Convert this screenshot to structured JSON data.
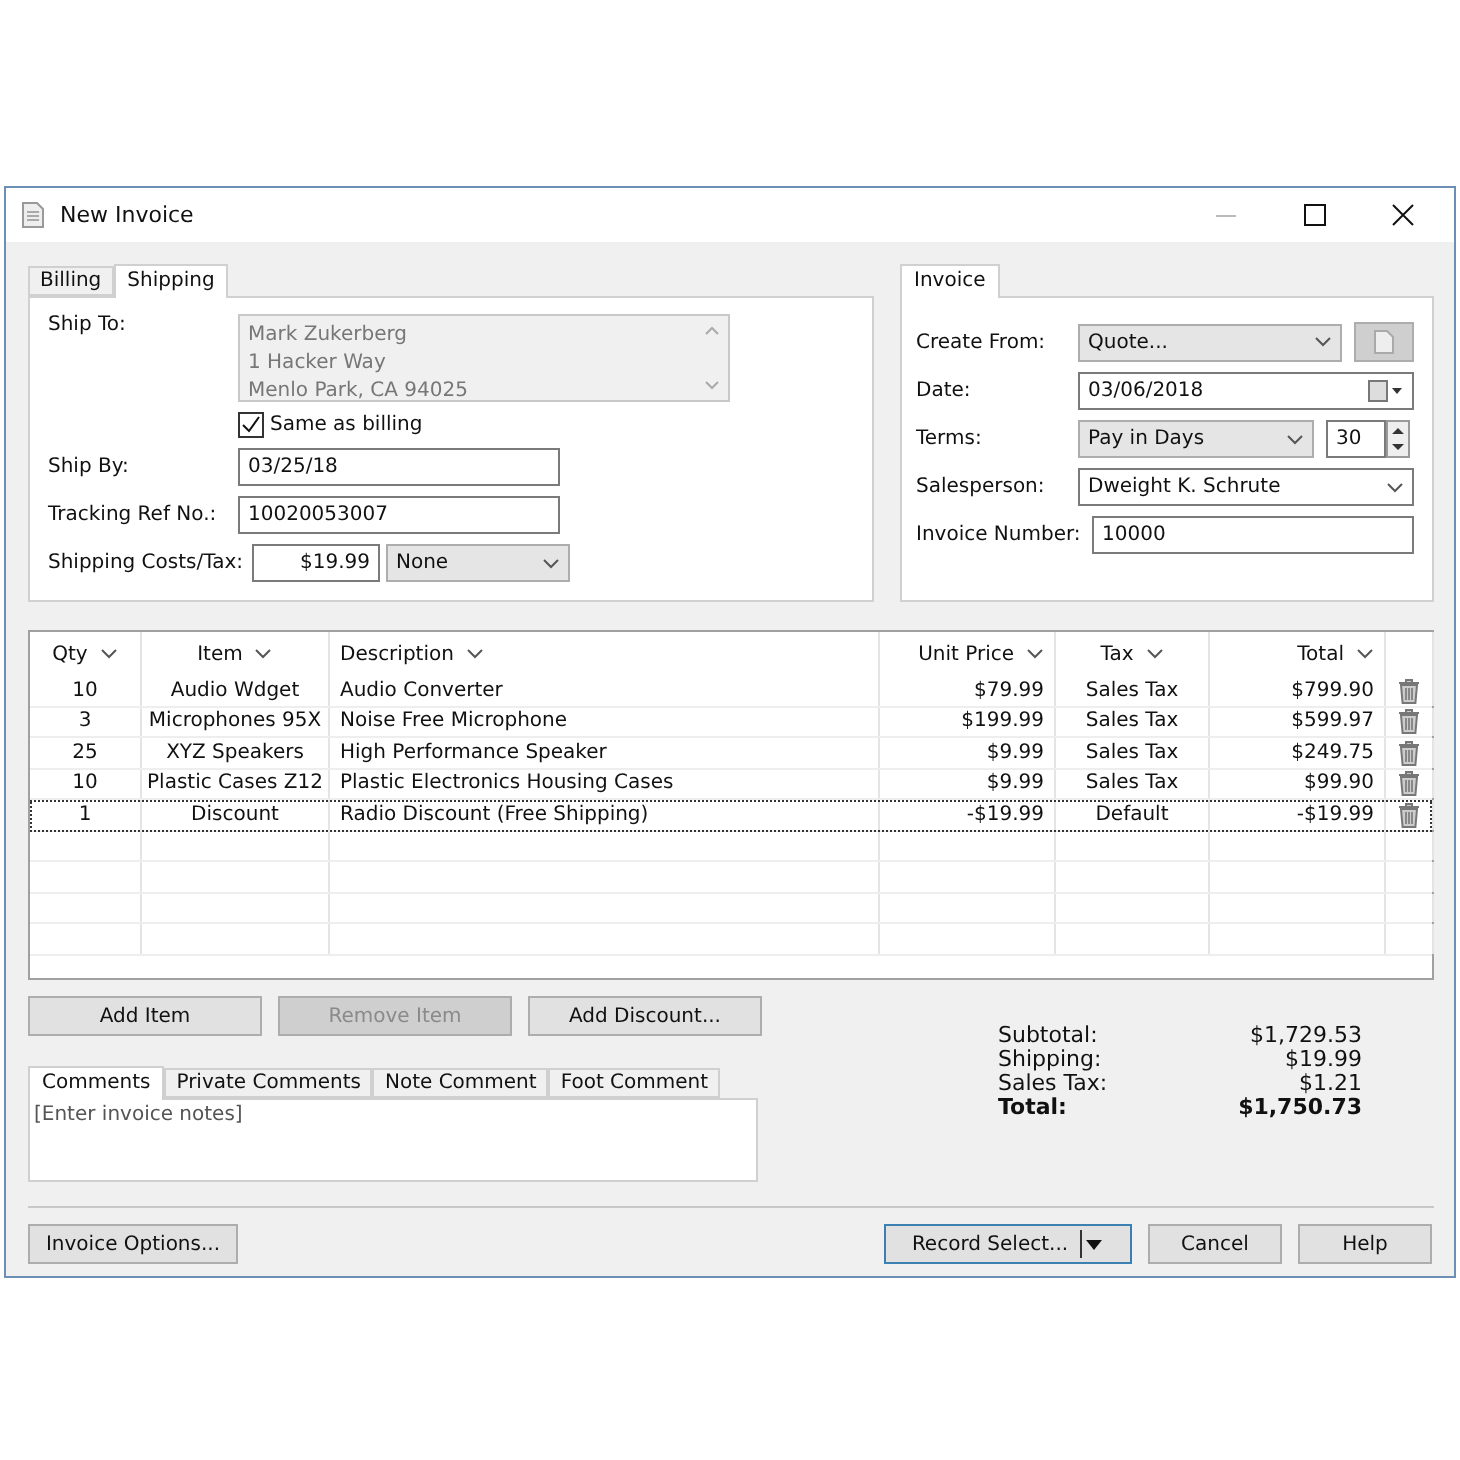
{
  "window": {
    "title": "New Invoice"
  },
  "address_tabs": [
    {
      "label": "Billing",
      "selected": false
    },
    {
      "label": "Shipping",
      "selected": true
    }
  ],
  "shipping": {
    "ship_to_label": "Ship To:",
    "ship_to_lines": [
      "Mark Zukerberg",
      "1 Hacker Way",
      "Menlo Park, CA 94025"
    ],
    "same_as_billing": {
      "label": "Same as billing",
      "checked": true
    },
    "ship_by": {
      "label": "Ship By:",
      "value": "03/25/18"
    },
    "tracking": {
      "label": "Tracking Ref No.:",
      "value": "10020053007"
    },
    "costs": {
      "label": "Shipping Costs/Tax:",
      "value": "$19.99",
      "tax": "None"
    }
  },
  "invoice_tabs": [
    {
      "label": "Invoice",
      "selected": true
    }
  ],
  "invoice": {
    "create_from": {
      "label": "Create From:",
      "value": "Quote..."
    },
    "date": {
      "label": "Date:",
      "value": "03/06/2018"
    },
    "terms": {
      "label": "Terms:",
      "value": "Pay in Days",
      "days": "30"
    },
    "salesperson": {
      "label": "Salesperson:",
      "value": "Dweight K. Schrute"
    },
    "number": {
      "label": "Invoice Number:",
      "value": "10000"
    }
  },
  "table": {
    "columns": [
      {
        "label": "Qty"
      },
      {
        "label": "Item"
      },
      {
        "label": "Description"
      },
      {
        "label": "Unit Price"
      },
      {
        "label": "Tax"
      },
      {
        "label": "Total"
      }
    ],
    "rows": [
      {
        "cells": [
          "10",
          "Audio Wdget",
          "Audio Converter",
          "$79.99",
          "Sales Tax",
          "$799.90"
        ],
        "selected": false
      },
      {
        "cells": [
          "3",
          "Microphones 95X",
          "Noise Free Microphone",
          "$199.99",
          "Sales Tax",
          "$599.97"
        ],
        "selected": false
      },
      {
        "cells": [
          "25",
          "XYZ Speakers",
          "High Performance Speaker",
          "$9.99",
          "Sales Tax",
          "$249.75"
        ],
        "selected": false
      },
      {
        "cells": [
          "10",
          "Plastic Cases Z12",
          "Plastic Electronics Housing Cases",
          "$9.99",
          "Sales Tax",
          "$99.90"
        ],
        "selected": false
      },
      {
        "cells": [
          "1",
          "Discount",
          "Radio Discount (Free Shipping)",
          "-$19.99",
          "Default",
          "-$19.99"
        ],
        "selected": true
      }
    ]
  },
  "item_buttons": [
    {
      "label": "Add Item",
      "disabled": false
    },
    {
      "label": "Remove Item",
      "disabled": true
    },
    {
      "label": "Add Discount...",
      "disabled": false
    }
  ],
  "comment_tabs": [
    {
      "label": "Comments",
      "selected": true
    },
    {
      "label": "Private Comments",
      "selected": false
    },
    {
      "label": "Note Comment",
      "selected": false
    },
    {
      "label": "Foot Comment",
      "selected": false
    }
  ],
  "comments": {
    "placeholder": "[Enter invoice notes]"
  },
  "totals": [
    {
      "label": "Subtotal:",
      "value": "$1,729.53",
      "bold": false
    },
    {
      "label": "Shipping:",
      "value": "$19.99",
      "bold": false
    },
    {
      "label": "Sales Tax:",
      "value": "$1.21",
      "bold": false
    },
    {
      "label": "Total:",
      "value": "$1,750.73",
      "bold": true
    }
  ],
  "footer": {
    "options": "Invoice Options...",
    "buttons": [
      {
        "label": "Record Select...",
        "kind": "split",
        "default": true
      },
      {
        "label": "Cancel",
        "kind": "plain",
        "default": false
      },
      {
        "label": "Help",
        "kind": "plain",
        "default": false
      }
    ]
  }
}
